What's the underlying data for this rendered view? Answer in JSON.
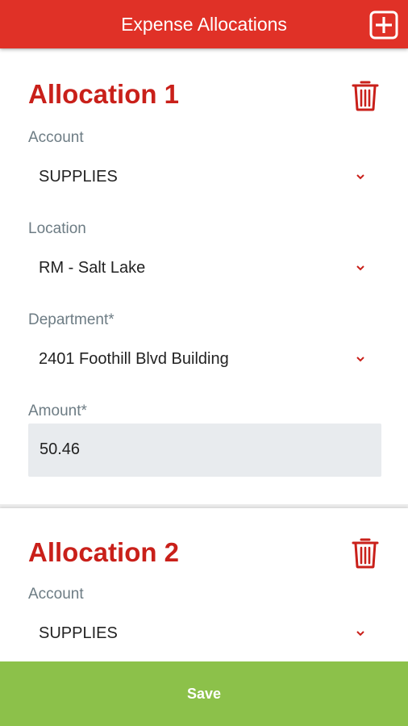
{
  "header": {
    "title": "Expense Allocations",
    "add_icon": "plus-square-icon"
  },
  "allocations": [
    {
      "title": "Allocation 1",
      "delete_icon": "trash-icon",
      "account": {
        "label": "Account",
        "value": "SUPPLIES"
      },
      "location": {
        "label": "Location",
        "value": "RM - Salt Lake"
      },
      "department": {
        "label": "Department*",
        "value": "2401 Foothill Blvd Building"
      },
      "amount": {
        "label": "Amount*",
        "value": "50.46"
      }
    },
    {
      "title": "Allocation 2",
      "delete_icon": "trash-icon",
      "account": {
        "label": "Account",
        "value": "SUPPLIES"
      }
    }
  ],
  "footer": {
    "save_label": "Save"
  },
  "colors": {
    "header_bg": "#e03127",
    "title_red": "#c9201a",
    "save_green": "#8cc14a",
    "label_gray": "#6d7c84",
    "input_bg": "#e8ebee"
  }
}
